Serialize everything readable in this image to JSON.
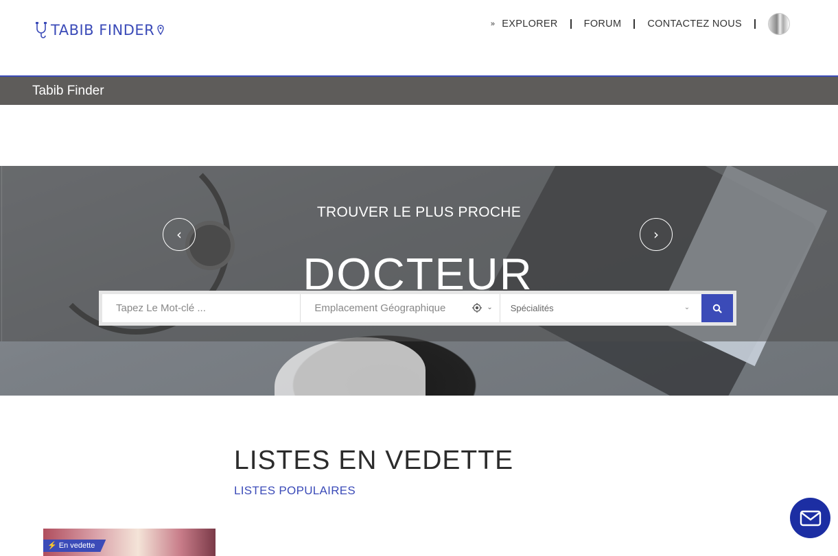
{
  "header": {
    "logo_text": "TABIB FINDER",
    "nav": {
      "explorer": "EXPLORER",
      "forum": "FORUM",
      "contact": "CONTACTEZ NOUS"
    }
  },
  "subbar": {
    "title": "Tabib Finder"
  },
  "hero": {
    "subtitle": "TROUVER LE PLUS PROCHE",
    "title": "DOCTEUR"
  },
  "search": {
    "keyword_placeholder": "Tapez Le Mot-clé ...",
    "location_placeholder": "Emplacement Géographique",
    "specialty_label": "Spécialités"
  },
  "featured": {
    "title": "LISTES EN VEDETTE",
    "subtitle": "LISTES POPULAIRES",
    "card_badge": "En vedette"
  },
  "colors": {
    "accent": "#3b4bb8",
    "subbar": "#5e5c5a",
    "mail_button": "#1c2ea3"
  }
}
